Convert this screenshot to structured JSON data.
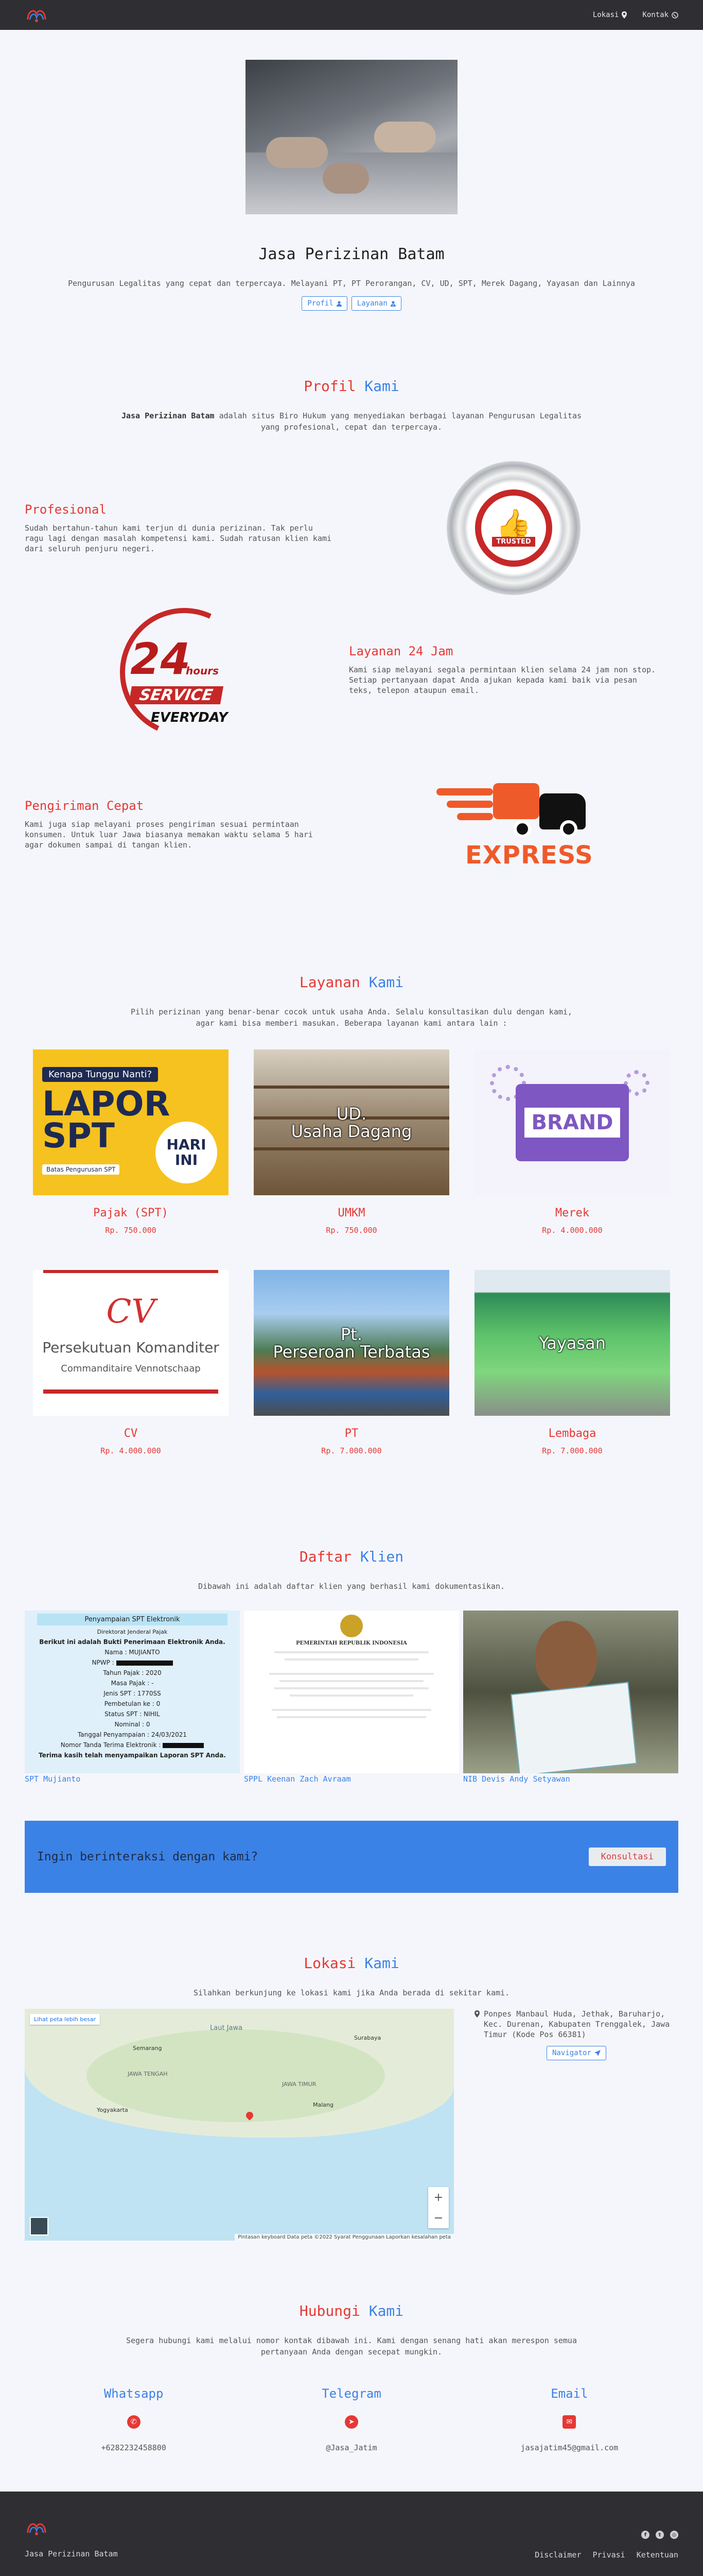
{
  "navbar": {
    "links": [
      {
        "label": "Lokasi",
        "icon": "map-marker-icon"
      },
      {
        "label": "Kontak",
        "icon": "whatsapp-icon"
      }
    ]
  },
  "hero": {
    "title": "Jasa Perizinan Batam",
    "subtitle": "Pengurusan Legalitas yang cepat dan terpercaya. Melayani PT, PT Perorangan, CV, UD, SPT, Merek Dagang, Yayasan dan Lainnya",
    "buttons": [
      "Profil",
      "Layanan"
    ]
  },
  "profil": {
    "title_a": "Profil",
    "title_b": "Kami",
    "desc_bold": "Jasa Perizinan Batam",
    "desc_rest": " adalah situs Biro Hukum yang menyediakan berbagai layanan Pengurusan Legalitas yang profesional, cepat dan terpercaya.",
    "features": [
      {
        "title": "Profesional",
        "text": "Sudah bertahun-tahun kami terjun di dunia perizinan. Tak perlu ragu lagi dengan masalah kompetensi kami. Sudah ratusan klien kami dari seluruh penjuru negeri."
      },
      {
        "title": "Layanan 24 Jam",
        "text": "Kami siap melayani segala permintaan klien selama 24 jam non stop. Setiap pertanyaan dapat Anda ajukan kepada kami baik via pesan teks, telepon ataupun email."
      },
      {
        "title": "Pengiriman Cepat",
        "text": "Kami juga siap melayani proses pengiriman sesuai permintaan konsumen. Untuk luar Jawa biasanya memakan waktu selama 5 hari agar dokumen sampai di tangan klien."
      }
    ],
    "badges": {
      "trusted": "TRUSTED",
      "service_num": "24",
      "service_hours": "hours",
      "service_word": "SERVICE",
      "service_every": "EVERYDAY",
      "express": "EXPRESS"
    }
  },
  "layanan": {
    "title_a": "Layanan",
    "title_b": "Kami",
    "desc": "Pilih perizinan yang benar-benar cocok untuk usaha Anda. Selalu konsultasikan dulu dengan kami, agar kami bisa memberi masukan. Beberapa layanan kami antara lain :",
    "items": [
      {
        "title": "Pajak (SPT)",
        "price": "Rp. 750.000"
      },
      {
        "title": "UMKM",
        "price": "Rp. 750.000"
      },
      {
        "title": "Merek",
        "price": "Rp. 4.000.000"
      },
      {
        "title": "CV",
        "price": "Rp. 4.000.000"
      },
      {
        "title": "PT",
        "price": "Rp. 7.000.000"
      },
      {
        "title": "Lembaga",
        "price": "Rp. 7.000.000"
      }
    ],
    "images": {
      "spt_head": "Kenapa Tunggu Nanti?",
      "spt_big": "LAPOR SPT",
      "spt_hari": "HARI INI",
      "spt_batas": "Batas Pengurusan SPT",
      "umkm_overlay_1": "UD.",
      "umkm_overlay_2": "Usaha Dagang",
      "merek_brand": "BRAND",
      "cv_big": "CV",
      "cv_line1": "Persekutuan Komanditer",
      "cv_line2": "Commanditaire Vennotschaap",
      "pt_overlay_1": "Pt.",
      "pt_overlay_2": "Perseroan Terbatas",
      "lembaga_overlay": "Yayasan"
    }
  },
  "klien": {
    "title_a": "Daftar",
    "title_b": "Klien",
    "desc": "Dibawah ini adalah daftar klien yang berhasil kami dokumentasikan.",
    "items": [
      {
        "caption": "SPT Mujianto"
      },
      {
        "caption": "SPPL Keenan Zach Avraam"
      },
      {
        "caption": "NIB Devis Andy Setyawan"
      }
    ],
    "k1": {
      "head": "Penyampaian SPT Elektronik",
      "sub": "Direktorat Jenderal Pajak",
      "intro": "Berikut ini adalah Bukti Penerimaan Elektronik Anda.",
      "rows": [
        "Nama : MUJIANTO",
        "NPWP :",
        "Tahun Pajak : 2020",
        "Masa Pajak : -",
        "Jenis SPT : 1770SS",
        "Pembetulan ke : 0",
        "Status SPT : NIHIL",
        "Nominal : 0",
        "Tanggal Penyampaian : 24/03/2021",
        "Nomor Tanda Terima Elektronik :"
      ],
      "footer": "Terima kasih telah menyampaikan Laporan SPT Anda."
    },
    "k2": {
      "head": "PEMERINTAH REPUBLIK INDONESIA"
    }
  },
  "cta": {
    "text": "Ingin berinteraksi dengan kami?",
    "button": "Konsultasi"
  },
  "lokasi": {
    "title_a": "Lokasi",
    "title_b": "Kami",
    "desc": "Silahkan berkunjung ke lokasi kami jika Anda berada di sekitar kami.",
    "address": "Ponpes Manbaul Huda, Jethak, Baruharjo, Kec. Durenan, Kabupaten Trenggalek, Jawa Timur (Kode Pos 66381)",
    "button": "Navigator",
    "map": {
      "larger_link": "Lihat peta lebih besar",
      "sea": "Laut Jawa",
      "cities": [
        "Semarang",
        "JAWA TENGAH",
        "Surabaya",
        "JAWA TIMUR",
        "Malang",
        "Yogyakarta"
      ],
      "attribution": "Pintasan keyboard   Data peta ©2022   Syarat Penggunaan   Laporkan kesalahan peta"
    }
  },
  "hubungi": {
    "title_a": "Hubungi",
    "title_b": "Kami",
    "desc": "Segera hubungi kami melalui nomor kontak dibawah ini. Kami dengan senang hati akan merespon semua pertanyaan Anda dengan secepat mungkin.",
    "contacts": [
      {
        "name": "Whatsapp",
        "icon": "whatsapp-icon",
        "glyph": "✆",
        "value": "+6282232458800"
      },
      {
        "name": "Telegram",
        "icon": "telegram-icon",
        "glyph": "➤",
        "value": "@Jasa_Jatim"
      },
      {
        "name": "Email",
        "icon": "envelope-icon",
        "glyph": "✉",
        "value": "jasajatim45@gmail.com"
      }
    ]
  },
  "footer": {
    "brand": "Jasa Perizinan Batam",
    "socials": [
      {
        "icon": "facebook-icon",
        "glyph": "f"
      },
      {
        "icon": "twitter-icon",
        "glyph": "t"
      },
      {
        "icon": "instagram-icon",
        "glyph": "◎"
      }
    ],
    "links": [
      "Disclaimer",
      "Privasi",
      "Ketentuan"
    ]
  },
  "colors": {
    "accent_red": "#e53935",
    "accent_blue": "#3b82e6",
    "dark": "#2f2f33"
  }
}
